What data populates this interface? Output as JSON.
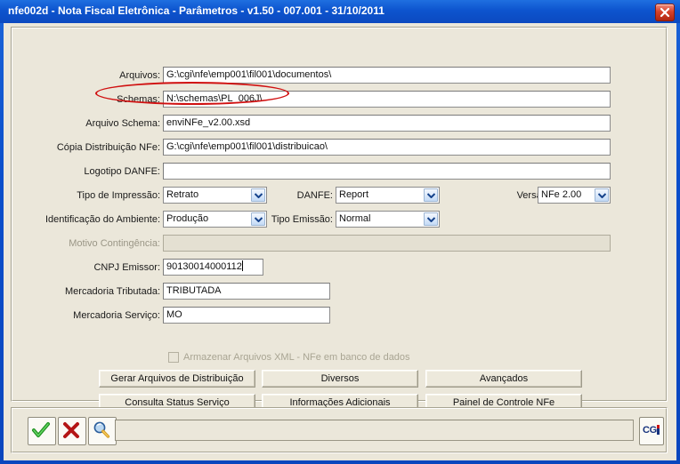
{
  "window": {
    "title": "nfe002d - Nota Fiscal Eletrônica - Parâmetros - v1.50 - 007.001 - 31/10/2011",
    "close_icon": "close-icon",
    "titlebar_color": "#0D54CE",
    "client_bg": "#EBE7DA"
  },
  "annotation": {
    "shape": "red-ellipse-highlight",
    "color": "#D01010",
    "target": "schemas-field"
  },
  "form": {
    "fields": [
      {
        "label": "Arquivos:",
        "value": "G:\\cgi\\nfe\\emp001\\fil001\\documentos\\"
      },
      {
        "label": "Schemas:",
        "value": "N:\\schemas\\PL_006J\\"
      },
      {
        "label": "Arquivo Schema:",
        "value": "enviNFe_v2.00.xsd"
      },
      {
        "label": "Cópia Distribuição NFe:",
        "value": "G:\\cgi\\nfe\\emp001\\fil001\\distribuicao\\"
      },
      {
        "label": "Logotipo DANFE:",
        "value": ""
      }
    ],
    "combos": [
      {
        "label": "Tipo de Impressão:",
        "value": "Retrato"
      },
      {
        "label": "DANFE:",
        "value": "Report"
      },
      {
        "label": "Versão da NFe:",
        "value": "NFe 2.00"
      },
      {
        "label": "Identificação do Ambiente:",
        "value": "Produção"
      },
      {
        "label": "Tipo Emissão:",
        "value": "Normal"
      }
    ],
    "motivo": {
      "label": "Motivo Contingência:",
      "value": ""
    },
    "lower_fields": [
      {
        "label": "CNPJ Emissor:",
        "value": "90130014000112"
      },
      {
        "label": "Mercadoria Tributada:",
        "value": "TRIBUTADA"
      },
      {
        "label": "Mercadoria Serviço:",
        "value": "MO"
      }
    ],
    "checkbox": {
      "label": "Armazenar Arquivos XML - NFe em banco de dados",
      "checked": false
    }
  },
  "buttons": {
    "row1": [
      {
        "label": "Gerar Arquivos de Distribuição"
      },
      {
        "label": "Diversos"
      },
      {
        "label": "Avançados"
      }
    ],
    "row2": [
      {
        "label": "Consulta Status Serviço"
      },
      {
        "label": "Informações Adicionais"
      },
      {
        "label": "Painel de Controle NFe"
      }
    ]
  },
  "toolbar": {
    "confirm_icon": "check-icon",
    "cancel_icon": "x-icon",
    "search_icon": "magnifier-icon",
    "status_text": "",
    "logo_text": "CG",
    "logo_suffix": "i"
  }
}
